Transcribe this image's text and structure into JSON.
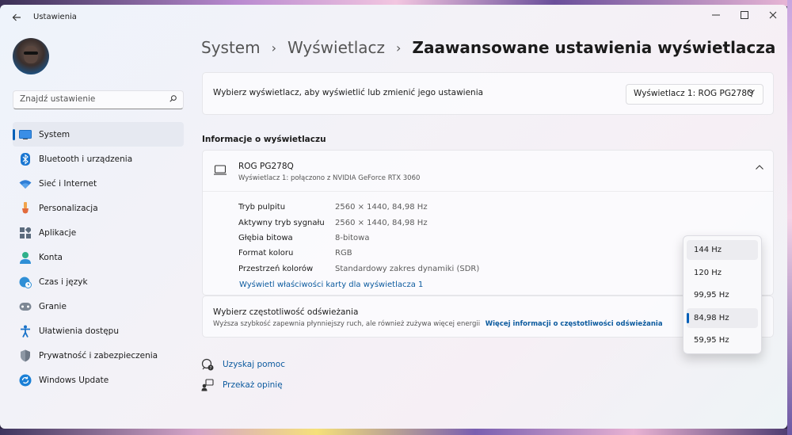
{
  "app": {
    "title": "Ustawienia",
    "back_icon": "arrow-left-icon",
    "window_controls": [
      "minimize-icon",
      "maximize-icon",
      "close-icon"
    ]
  },
  "sidebar": {
    "search_placeholder": "Znajdź ustawienie",
    "items": [
      {
        "label": "System",
        "icon": "monitor-icon",
        "active": true
      },
      {
        "label": "Bluetooth i urządzenia",
        "icon": "bluetooth-icon"
      },
      {
        "label": "Sieć i Internet",
        "icon": "wifi-icon"
      },
      {
        "label": "Personalizacja",
        "icon": "brush-icon"
      },
      {
        "label": "Aplikacje",
        "icon": "apps-icon"
      },
      {
        "label": "Konta",
        "icon": "person-icon"
      },
      {
        "label": "Czas i język",
        "icon": "globe-clock-icon"
      },
      {
        "label": "Granie",
        "icon": "gamepad-icon"
      },
      {
        "label": "Ułatwienia dostępu",
        "icon": "accessibility-icon"
      },
      {
        "label": "Prywatność i zabezpieczenia",
        "icon": "shield-icon"
      },
      {
        "label": "Windows Update",
        "icon": "update-icon"
      }
    ]
  },
  "breadcrumb": {
    "items": [
      "System",
      "Wyświetlacz"
    ],
    "current": "Zaawansowane ustawienia wyświetlacza"
  },
  "display_select": {
    "label": "Wybierz wyświetlacz, aby wyświetlić lub zmienić jego ustawienia",
    "value": "Wyświetlacz 1: ROG PG278Q"
  },
  "info_section": {
    "heading": "Informacje o wyświetlaczu",
    "monitor_name": "ROG PG278Q",
    "connection": "Wyświetlacz 1: połączono z NVIDIA GeForce RTX 3060",
    "properties": [
      {
        "label": "Tryb pulpitu",
        "value": "2560 × 1440, 84,98 Hz"
      },
      {
        "label": "Aktywny tryb sygnału",
        "value": "2560 × 1440, 84,98 Hz"
      },
      {
        "label": "Głębia bitowa",
        "value": "8-bitowa"
      },
      {
        "label": "Format koloru",
        "value": "RGB"
      },
      {
        "label": "Przestrzeń kolorów",
        "value": "Standardowy zakres dynamiki (SDR)"
      }
    ],
    "adapter_link": "Wyświetl właściwości karty dla wyświetlacza 1"
  },
  "refresh_rate": {
    "title": "Wybierz częstotliwość odświeżania",
    "description": "Wyższa szybkość zapewnia płynniejszy ruch, ale również zużywa więcej energii",
    "more_link": "Więcej informacji o częstotliwości odświeżania",
    "options": [
      "144 Hz",
      "120 Hz",
      "99,95 Hz",
      "84,98 Hz",
      "59,95 Hz"
    ],
    "selected": "84,98 Hz",
    "hovered": "144 Hz"
  },
  "help": {
    "get_help": "Uzyskaj pomoc",
    "feedback": "Przekaż opinię"
  }
}
